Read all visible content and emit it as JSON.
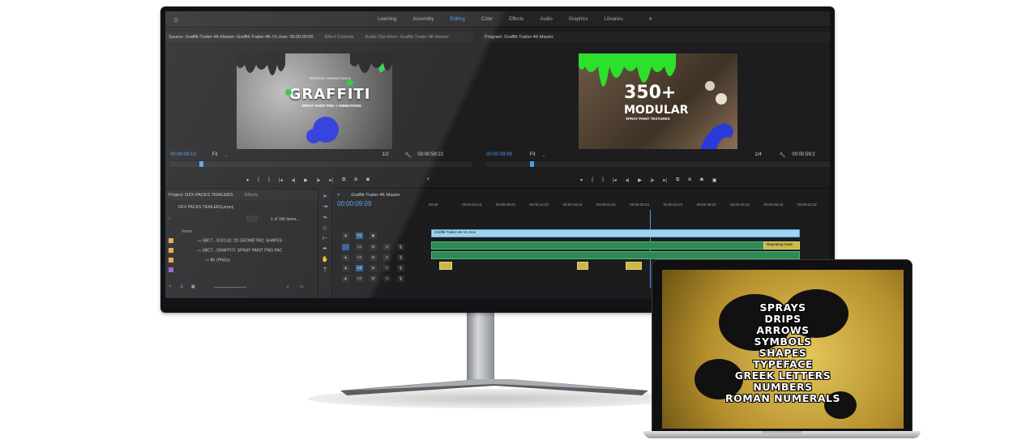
{
  "workspaces": {
    "tabs": [
      "Learning",
      "Assembly",
      "Editing",
      "Color",
      "Effects",
      "Audio",
      "Graphics",
      "Libraries"
    ],
    "active": "Editing",
    "more": "»"
  },
  "source": {
    "header": "Source: Graffiti-Trailer-4K-Master: Graffiti-Trailer-4K-V1.mov: 00:00:00:00",
    "tabs": [
      "Effect Controls",
      "Audio Clip Mixer: Graffiti-Trailer-4K-Master"
    ],
    "brand": "SIDEBOAT CINEMA TOOLS",
    "title": "GRAFFITI",
    "tagline": "SPRAY PAINT PNG + ANIMATIONS",
    "timecode": "00:00:04:10",
    "fit": "Fit",
    "ratio": "1/2",
    "duration": "00:00:59:22"
  },
  "program": {
    "header": "Program: Graffiti-Trailer-4K-Master",
    "big": "350+",
    "mid": "MODULAR",
    "small": "SPRAY PAINT TEXTURES",
    "timecode": "00:00:09:09",
    "fit": "Fit",
    "ratio": "1/4",
    "duration": "00:00:59:2"
  },
  "project": {
    "header": "Project: GFX PACKS TRAILERS",
    "effects_tab": "Effects",
    "file": "GFX PACKS TRAILERS.prproj",
    "count": "1 of 195 items...",
    "column": "Name",
    "items": [
      "SBCT - EUCLID: 2D GEOMETRIC SHAPES",
      "SBCT - GRAFFITI: SPRAY PAINT PNG PAC",
      "8K (PNGs)"
    ]
  },
  "timeline": {
    "tab": "Graffiti-Trailer-4K-Master",
    "timecode": "00:00:09:09",
    "ruler": [
      "00:00",
      "00:00:04:23",
      "00:00:09:23",
      "00:00:14:23",
      "00:00:19:23",
      "00:00:24:23",
      "00:00:29:23",
      "00:00:34:23",
      "00:00:39:23",
      "00:00:44:22",
      "00:00:49:22",
      "00:00:54:22"
    ],
    "tracks": [
      {
        "name": "V1",
        "label": "V1"
      },
      {
        "name": "A1",
        "label": "A1"
      },
      {
        "name": "A2",
        "label": "A2"
      },
      {
        "name": "A3",
        "label": "A3"
      },
      {
        "name": "A4",
        "label": "A4"
      }
    ],
    "video_clip": "Graffiti-Trailer-4K-V1.mov",
    "audio_clip_label": "Repeating Fade"
  },
  "laptop": {
    "words": [
      "SPRAYS",
      "DRIPS",
      "ARROWS",
      "SYMBOLS",
      "SHAPES",
      "TYPEFACE",
      "GREEK LETTERS",
      "NUMBERS",
      "ROMAN NUMERALS"
    ]
  }
}
